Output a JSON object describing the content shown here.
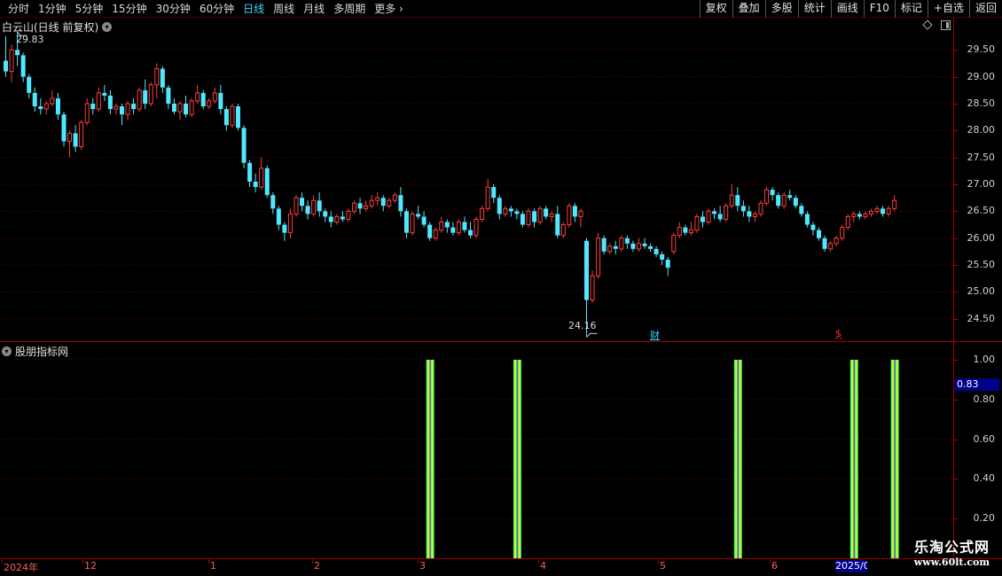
{
  "toolbar": {
    "periods": [
      "分时",
      "1分钟",
      "5分钟",
      "15分钟",
      "30分钟",
      "60分钟",
      "日线",
      "周线",
      "月线",
      "多周期",
      "更多"
    ],
    "active_period": "日线",
    "more_arrow": "›",
    "buttons": [
      "复权",
      "叠加",
      "多股",
      "统计",
      "画线",
      "F10",
      "标记",
      "+自选",
      "返回"
    ]
  },
  "price_pane": {
    "title": "白云山(日线 前复权)",
    "high_label": "29.83",
    "low_label": "24.16",
    "marker_cai": "财",
    "marker_dollar": "$",
    "axis_labels": [
      "29.50",
      "29.00",
      "28.50",
      "28.00",
      "27.50",
      "27.00",
      "26.50",
      "26.00",
      "25.50",
      "25.00",
      "24.50"
    ]
  },
  "indicator_pane": {
    "title": "股朋指标网",
    "axis_labels": [
      "1.00",
      "0.80",
      "0.60",
      "0.40",
      "0.20"
    ],
    "current_value": "0.83"
  },
  "datebar": {
    "labels": [
      "2024年",
      "12",
      "1",
      "2",
      "3",
      "4",
      "5",
      "6"
    ],
    "end_label": "2025/0"
  },
  "watermark": {
    "line1": "乐淘公式网",
    "line2": "www.60lt.com"
  },
  "colors": {
    "up": "#ff3c3c",
    "down": "#4fe8ff",
    "grid": "#7a0000",
    "active": "#3fd4ff"
  },
  "chart_data": {
    "type": "candlestick",
    "ylim": [
      24.2,
      29.9
    ],
    "up_color": "#ff3c3c",
    "down_color": "#4fe8ff",
    "candles": [
      [
        29.3,
        29.75,
        29.0,
        29.1
      ],
      [
        29.1,
        29.6,
        28.9,
        29.5
      ],
      [
        29.5,
        29.83,
        29.2,
        29.4
      ],
      [
        29.4,
        29.45,
        28.9,
        29.0
      ],
      [
        29.0,
        29.05,
        28.6,
        28.7
      ],
      [
        28.7,
        28.8,
        28.35,
        28.45
      ],
      [
        28.45,
        28.6,
        28.3,
        28.4
      ],
      [
        28.4,
        28.55,
        28.3,
        28.5
      ],
      [
        28.5,
        28.75,
        28.45,
        28.6
      ],
      [
        28.6,
        28.7,
        28.2,
        28.3
      ],
      [
        28.3,
        28.35,
        27.7,
        27.8
      ],
      [
        27.8,
        28.0,
        27.5,
        27.95
      ],
      [
        27.95,
        28.1,
        27.6,
        27.7
      ],
      [
        27.7,
        28.2,
        27.65,
        28.15
      ],
      [
        28.15,
        28.6,
        28.1,
        28.5
      ],
      [
        28.5,
        28.6,
        28.3,
        28.4
      ],
      [
        28.4,
        28.8,
        28.35,
        28.7
      ],
      [
        28.7,
        28.85,
        28.55,
        28.65
      ],
      [
        28.65,
        28.75,
        28.3,
        28.4
      ],
      [
        28.4,
        28.5,
        28.3,
        28.45
      ],
      [
        28.45,
        28.5,
        28.1,
        28.3
      ],
      [
        28.3,
        28.55,
        28.2,
        28.5
      ],
      [
        28.5,
        28.6,
        28.3,
        28.4
      ],
      [
        28.4,
        28.8,
        28.35,
        28.75
      ],
      [
        28.75,
        28.95,
        28.4,
        28.5
      ],
      [
        28.5,
        28.9,
        28.45,
        28.85
      ],
      [
        28.85,
        29.25,
        28.6,
        29.15
      ],
      [
        29.15,
        29.2,
        28.7,
        28.8
      ],
      [
        28.8,
        28.85,
        28.4,
        28.5
      ],
      [
        28.5,
        28.6,
        28.3,
        28.35
      ],
      [
        28.35,
        28.55,
        28.2,
        28.5
      ],
      [
        28.5,
        28.65,
        28.25,
        28.3
      ],
      [
        28.3,
        28.6,
        28.25,
        28.55
      ],
      [
        28.55,
        28.85,
        28.5,
        28.7
      ],
      [
        28.7,
        28.75,
        28.4,
        28.45
      ],
      [
        28.45,
        28.6,
        28.4,
        28.55
      ],
      [
        28.55,
        28.8,
        28.5,
        28.7
      ],
      [
        28.7,
        28.85,
        28.3,
        28.4
      ],
      [
        28.4,
        28.45,
        28.0,
        28.1
      ],
      [
        28.1,
        28.5,
        28.05,
        28.45
      ],
      [
        28.45,
        28.5,
        28.0,
        28.05
      ],
      [
        28.05,
        28.1,
        27.3,
        27.4
      ],
      [
        27.4,
        27.45,
        26.95,
        27.05
      ],
      [
        27.05,
        27.2,
        26.85,
        26.95
      ],
      [
        26.95,
        27.5,
        26.9,
        27.3
      ],
      [
        27.3,
        27.35,
        26.75,
        26.8
      ],
      [
        26.8,
        26.85,
        26.45,
        26.55
      ],
      [
        26.55,
        26.6,
        26.15,
        26.25
      ],
      [
        26.25,
        26.3,
        25.95,
        26.1
      ],
      [
        26.1,
        26.55,
        26.0,
        26.45
      ],
      [
        26.45,
        26.8,
        26.4,
        26.75
      ],
      [
        26.75,
        26.85,
        26.5,
        26.6
      ],
      [
        26.6,
        26.7,
        26.35,
        26.45
      ],
      [
        26.45,
        26.8,
        26.4,
        26.7
      ],
      [
        26.7,
        26.85,
        26.4,
        26.5
      ],
      [
        26.5,
        26.55,
        26.3,
        26.4
      ],
      [
        26.4,
        26.5,
        26.2,
        26.3
      ],
      [
        26.3,
        26.45,
        26.25,
        26.4
      ],
      [
        26.4,
        26.5,
        26.3,
        26.35
      ],
      [
        26.35,
        26.55,
        26.3,
        26.5
      ],
      [
        26.5,
        26.7,
        26.45,
        26.65
      ],
      [
        26.65,
        26.75,
        26.45,
        26.55
      ],
      [
        26.55,
        26.7,
        26.5,
        26.6
      ],
      [
        26.6,
        26.8,
        26.55,
        26.7
      ],
      [
        26.7,
        26.85,
        26.6,
        26.75
      ],
      [
        26.75,
        26.8,
        26.5,
        26.6
      ],
      [
        26.6,
        26.75,
        26.55,
        26.7
      ],
      [
        26.7,
        26.85,
        26.65,
        26.8
      ],
      [
        26.8,
        26.95,
        26.4,
        26.5
      ],
      [
        26.5,
        26.55,
        26.0,
        26.1
      ],
      [
        26.1,
        26.5,
        26.05,
        26.45
      ],
      [
        26.45,
        26.6,
        26.35,
        26.4
      ],
      [
        26.4,
        26.5,
        26.2,
        26.25
      ],
      [
        26.25,
        26.3,
        25.95,
        26.0
      ],
      [
        26.0,
        26.2,
        25.95,
        26.15
      ],
      [
        26.15,
        26.4,
        26.1,
        26.3
      ],
      [
        26.3,
        26.35,
        26.1,
        26.2
      ],
      [
        26.2,
        26.3,
        26.05,
        26.1
      ],
      [
        26.1,
        26.35,
        26.05,
        26.3
      ],
      [
        26.3,
        26.4,
        26.1,
        26.15
      ],
      [
        26.15,
        26.3,
        26.0,
        26.05
      ],
      [
        26.05,
        26.4,
        26.0,
        26.35
      ],
      [
        26.35,
        26.6,
        26.3,
        26.55
      ],
      [
        26.55,
        27.1,
        26.5,
        26.95
      ],
      [
        26.95,
        27.0,
        26.65,
        26.75
      ],
      [
        26.75,
        26.8,
        26.35,
        26.45
      ],
      [
        26.45,
        26.6,
        26.4,
        26.55
      ],
      [
        26.55,
        26.6,
        26.4,
        26.5
      ],
      [
        26.5,
        26.55,
        26.35,
        26.45
      ],
      [
        26.45,
        26.5,
        26.2,
        26.25
      ],
      [
        26.25,
        26.55,
        26.2,
        26.5
      ],
      [
        26.5,
        26.55,
        26.2,
        26.3
      ],
      [
        26.3,
        26.6,
        26.25,
        26.55
      ],
      [
        26.55,
        26.6,
        26.35,
        26.4
      ],
      [
        26.4,
        26.5,
        26.3,
        26.45
      ],
      [
        26.45,
        26.6,
        26.0,
        26.05
      ],
      [
        26.05,
        26.3,
        26.0,
        26.25
      ],
      [
        26.25,
        26.65,
        26.2,
        26.6
      ],
      [
        26.6,
        26.65,
        26.3,
        26.4
      ],
      [
        26.4,
        26.55,
        26.2,
        26.5
      ],
      [
        25.95,
        26.0,
        24.16,
        24.85
      ],
      [
        24.85,
        25.4,
        24.8,
        25.3
      ],
      [
        25.3,
        26.1,
        25.25,
        26.0
      ],
      [
        26.0,
        26.05,
        25.7,
        25.75
      ],
      [
        25.75,
        25.9,
        25.7,
        25.85
      ],
      [
        25.85,
        25.95,
        25.7,
        25.8
      ],
      [
        25.8,
        26.05,
        25.75,
        26.0
      ],
      [
        26.0,
        26.05,
        25.8,
        25.9
      ],
      [
        25.9,
        25.95,
        25.75,
        25.8
      ],
      [
        25.8,
        26.0,
        25.75,
        25.9
      ],
      [
        25.9,
        26.0,
        25.8,
        25.85
      ],
      [
        25.85,
        25.9,
        25.75,
        25.8
      ],
      [
        25.8,
        25.85,
        25.65,
        25.7
      ],
      [
        25.7,
        25.75,
        25.5,
        25.6
      ],
      [
        25.6,
        25.65,
        25.3,
        25.45
      ],
      [
        25.75,
        26.1,
        25.7,
        26.05
      ],
      [
        26.05,
        26.3,
        26.0,
        26.2
      ],
      [
        26.2,
        26.25,
        26.05,
        26.1
      ],
      [
        26.1,
        26.3,
        26.05,
        26.15
      ],
      [
        26.15,
        26.45,
        26.1,
        26.4
      ],
      [
        26.4,
        26.5,
        26.2,
        26.3
      ],
      [
        26.3,
        26.55,
        26.25,
        26.5
      ],
      [
        26.5,
        26.55,
        26.35,
        26.45
      ],
      [
        26.45,
        26.6,
        26.3,
        26.35
      ],
      [
        26.35,
        26.65,
        26.3,
        26.6
      ],
      [
        26.6,
        27.0,
        26.55,
        26.8
      ],
      [
        26.8,
        26.95,
        26.5,
        26.6
      ],
      [
        26.6,
        26.7,
        26.4,
        26.5
      ],
      [
        26.5,
        26.6,
        26.3,
        26.4
      ],
      [
        26.4,
        26.5,
        26.3,
        26.45
      ],
      [
        26.45,
        26.7,
        26.4,
        26.65
      ],
      [
        26.65,
        26.95,
        26.6,
        26.9
      ],
      [
        26.9,
        26.95,
        26.7,
        26.8
      ],
      [
        26.8,
        26.85,
        26.55,
        26.6
      ],
      [
        26.6,
        26.85,
        26.55,
        26.8
      ],
      [
        26.8,
        26.9,
        26.7,
        26.75
      ],
      [
        26.75,
        26.8,
        26.55,
        26.6
      ],
      [
        26.6,
        26.65,
        26.4,
        26.45
      ],
      [
        26.45,
        26.5,
        26.2,
        26.25
      ],
      [
        26.25,
        26.3,
        26.05,
        26.15
      ],
      [
        26.15,
        26.2,
        25.95,
        26.0
      ],
      [
        26.0,
        26.05,
        25.75,
        25.8
      ],
      [
        25.8,
        25.95,
        25.75,
        25.9
      ],
      [
        25.9,
        26.05,
        25.85,
        26.0
      ],
      [
        26.0,
        26.25,
        25.95,
        26.2
      ],
      [
        26.2,
        26.45,
        26.15,
        26.4
      ],
      [
        26.4,
        26.5,
        26.3,
        26.45
      ],
      [
        26.45,
        26.5,
        26.35,
        26.4
      ],
      [
        26.4,
        26.5,
        26.35,
        26.45
      ],
      [
        26.45,
        26.55,
        26.4,
        26.5
      ],
      [
        26.5,
        26.6,
        26.45,
        26.55
      ],
      [
        26.55,
        26.6,
        26.4,
        26.45
      ],
      [
        26.45,
        26.6,
        26.4,
        26.55
      ],
      [
        26.55,
        26.8,
        26.5,
        26.7
      ]
    ]
  },
  "indicator_data": {
    "type": "bar",
    "ylim": [
      0,
      1.1
    ],
    "signal_indices": [
      73,
      88,
      126,
      146,
      153
    ],
    "values": [
      1,
      1,
      1,
      1,
      1
    ]
  }
}
